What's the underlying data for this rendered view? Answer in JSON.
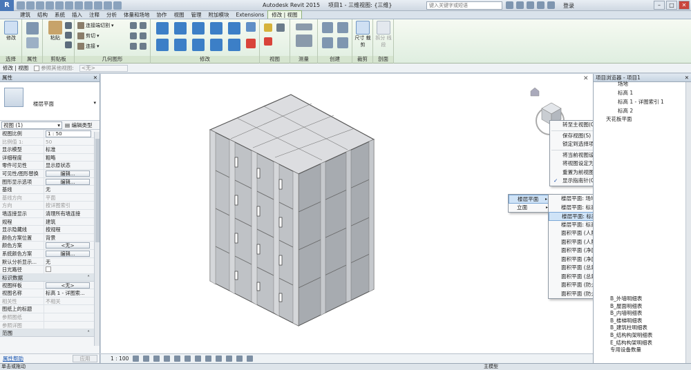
{
  "titlebar": {
    "app_logo": "R",
    "app_name": "Autodesk Revit 2015",
    "doc_title": "项目1 - 三维视图: {三维}",
    "search_placeholder": "键入关键字或短语",
    "login": "登录",
    "minimize": "–",
    "maximize": "□",
    "close": "✕"
  },
  "ribbon_tabs": [
    "建筑",
    "结构",
    "系统",
    "插入",
    "注释",
    "分析",
    "体量和场地",
    "协作",
    "视图",
    "管理",
    "附加模块",
    "Extensions",
    "修改 | 视图"
  ],
  "ribbon_active_tab": "修改 | 视图",
  "ribbon": {
    "select_group": {
      "button": "修改",
      "label": "选择"
    },
    "props_group": {
      "label": "属性"
    },
    "clipboard_group": {
      "paste": "粘贴",
      "label": "剪贴板"
    },
    "geometry_group": {
      "join_cut": "连接端切割",
      "cut": "剪切",
      "join": "连接",
      "label": "几何图形"
    },
    "modify_group": {
      "label": "修改"
    },
    "view_group": {
      "label": "视图"
    },
    "measure_group": {
      "label": "测量"
    },
    "create_group": {
      "label": "创建"
    },
    "crop_group": {
      "button": "尺寸 裁剪",
      "label": "裁剪"
    },
    "section_group": {
      "button": "拆分 线段",
      "label": "剖面"
    }
  },
  "optbar": {
    "context": "修改 | 视图",
    "checkbox_label": "参照其他视图:",
    "dropdown_value": "<无>"
  },
  "properties": {
    "title": "属性",
    "close": "✕",
    "type_name": "楼层平面",
    "view_selector": "视图 (1)",
    "edit_type": "编辑类型",
    "rows": [
      {
        "k": "视图比例",
        "v": "1 : 50",
        "kind": "input"
      },
      {
        "k": "比例值 1:",
        "v": "50",
        "kind": "dim"
      },
      {
        "k": "显示模型",
        "v": "标准"
      },
      {
        "k": "详细程度",
        "v": "粗略"
      },
      {
        "k": "零件可见性",
        "v": "显示原状态"
      },
      {
        "k": "可见性/图形替换",
        "v": "编辑...",
        "kind": "btn"
      },
      {
        "k": "图形显示选项",
        "v": "编辑...",
        "kind": "btn"
      },
      {
        "k": "基线",
        "v": "无"
      },
      {
        "k": "基线方向",
        "v": "平面",
        "kind": "dim"
      },
      {
        "k": "方向",
        "v": "按详图索引",
        "kind": "dim"
      },
      {
        "k": "墙连接显示",
        "v": "清理所有墙连接"
      },
      {
        "k": "规程",
        "v": "建筑"
      },
      {
        "k": "显示隐藏线",
        "v": "按规程"
      },
      {
        "k": "颜色方案位置",
        "v": "背景"
      },
      {
        "k": "颜色方案",
        "v": "<无>",
        "kind": "btn"
      },
      {
        "k": "系统颜色方案",
        "v": "编辑...",
        "kind": "btn"
      },
      {
        "k": "默认分析显示...",
        "v": "无"
      },
      {
        "k": "日光路径",
        "v": "",
        "kind": "check"
      }
    ],
    "section_identity": "标识数据",
    "rows2": [
      {
        "k": "视图样板",
        "v": "<无>",
        "kind": "btn"
      },
      {
        "k": "视图名称",
        "v": "标高 1 - 详图索..."
      },
      {
        "k": "相关性",
        "v": "不相关",
        "kind": "dim"
      },
      {
        "k": "图纸上的标题",
        "v": ""
      },
      {
        "k": "参照图纸",
        "v": "",
        "kind": "dim"
      },
      {
        "k": "参照详图",
        "v": "",
        "kind": "dim"
      }
    ],
    "section_range": "范围",
    "help_link": "属性帮助",
    "apply": "应用"
  },
  "canvas": {
    "scale": "1 : 100",
    "close": "✕"
  },
  "context_menu_main": {
    "items": [
      {
        "label": "转至主视图(G)",
        "right": "主视图"
      },
      {
        "label": "保存视图(S)"
      },
      {
        "label": "锁定到选择项(L)"
      },
      {
        "label": "将当前视图设定为主视图(T)"
      },
      {
        "label": "将视图设定为前视图(F)",
        "sub": true
      },
      {
        "label": "重置为前视图(R)"
      },
      {
        "label": "显示指南针(C)",
        "checked": true
      }
    ],
    "check": "✓",
    "arrow": "▸"
  },
  "context_menu_orient": {
    "items": [
      {
        "label": "楼层平面",
        "sub": true,
        "highlighted": true
      },
      {
        "label": "立面",
        "sub": true
      }
    ]
  },
  "context_menu_plans": {
    "items": [
      "楼层平面: 场地",
      "楼层平面: 标高 1",
      "楼层平面: 标高 1 - 详图索引 1",
      "楼层平面: 标高 2",
      "面积平面 (人防分区面积): 标高 1",
      "面积平面 (人防分区面积): 标高 2",
      "面积平面 (净面积): 标高 1",
      "面积平面 (净面积): 标高 2",
      "面积平面 (总建筑面积): 标高 1",
      "面积平面 (总建筑面积): 标高 2",
      "面积平面 (防火分区面积): 标高 1",
      "面积平面 (防火分区面积): 标高 2"
    ],
    "highlighted_index": 2
  },
  "browser": {
    "title": "项目浏览器 - 项目1",
    "close": "✕",
    "tree_top": [
      "场地",
      "标高 1",
      "标高 1 - 详图索引 1",
      "标高 2",
      "天花板平面"
    ],
    "tree_bottom": [
      "B_外墙明细表",
      "B_屋面明细表",
      "B_内墙明细表",
      "B_楼梯明细表",
      "B_建筑柱明细表",
      "B_结构构架明细表",
      "E_结构构架明细表",
      "专用设备数量"
    ]
  },
  "statusbar": {
    "hint": "单击或拖动",
    "model": "主模型"
  },
  "colors": {
    "ribbon_bg": "#eef7e8",
    "menu_highlight": "#cfe3f7",
    "title_bg": "#dfe7ef",
    "building_roof": "#d9dbdd",
    "building_wall": "#b5b9bd"
  }
}
